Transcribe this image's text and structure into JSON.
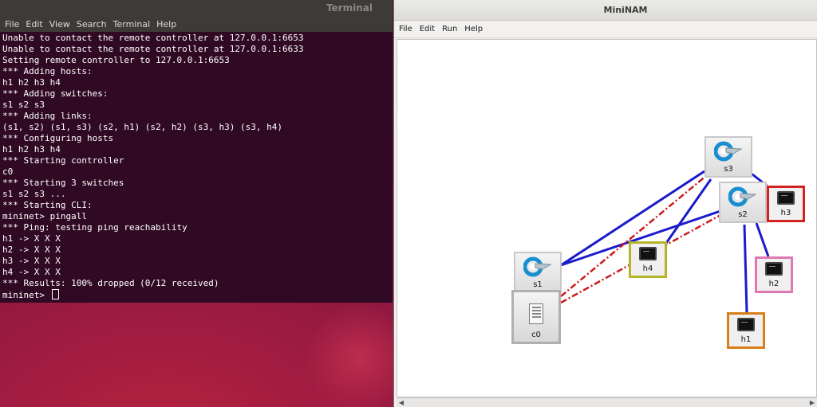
{
  "terminal": {
    "title": "Terminal",
    "menu": [
      "File",
      "Edit",
      "View",
      "Search",
      "Terminal",
      "Help"
    ],
    "lines": [
      "Unable to contact the remote controller at 127.0.0.1:6653",
      "Unable to contact the remote controller at 127.0.0.1:6633",
      "Setting remote controller to 127.0.0.1:6653",
      "*** Adding hosts:",
      "h1 h2 h3 h4",
      "*** Adding switches:",
      "s1 s2 s3",
      "*** Adding links:",
      "(s1, s2) (s1, s3) (s2, h1) (s2, h2) (s3, h3) (s3, h4)",
      "*** Configuring hosts",
      "h1 h2 h3 h4",
      "*** Starting controller",
      "c0",
      "*** Starting 3 switches",
      "s1 s2 s3 ...",
      "*** Starting CLI:",
      "mininet> pingall",
      "*** Ping: testing ping reachability",
      "h1 -> X X X",
      "h2 -> X X X",
      "h3 -> X X X",
      "h4 -> X X X",
      "*** Results: 100% dropped (0/12 received)"
    ],
    "prompt": "mininet> "
  },
  "mininam": {
    "title": "MiniNAM",
    "menu": [
      "File",
      "Edit",
      "Run",
      "Help"
    ],
    "nodes": {
      "s1": {
        "label": "s1",
        "type": "switch"
      },
      "s2": {
        "label": "s2",
        "type": "switch"
      },
      "s3": {
        "label": "s3",
        "type": "switch"
      },
      "h1": {
        "label": "h1",
        "type": "host",
        "border": "#d97f1a"
      },
      "h2": {
        "label": "h2",
        "type": "host",
        "border": "#e078b4"
      },
      "h3": {
        "label": "h3",
        "type": "host",
        "border": "#d42020"
      },
      "h4": {
        "label": "h4",
        "type": "host",
        "border": "#b5b52a"
      },
      "c0": {
        "label": "c0",
        "type": "controller"
      }
    },
    "colors": {
      "link": "#1a1acc",
      "control_link": "#cc1a1a",
      "switch_icon": "#1a8fcf"
    }
  }
}
